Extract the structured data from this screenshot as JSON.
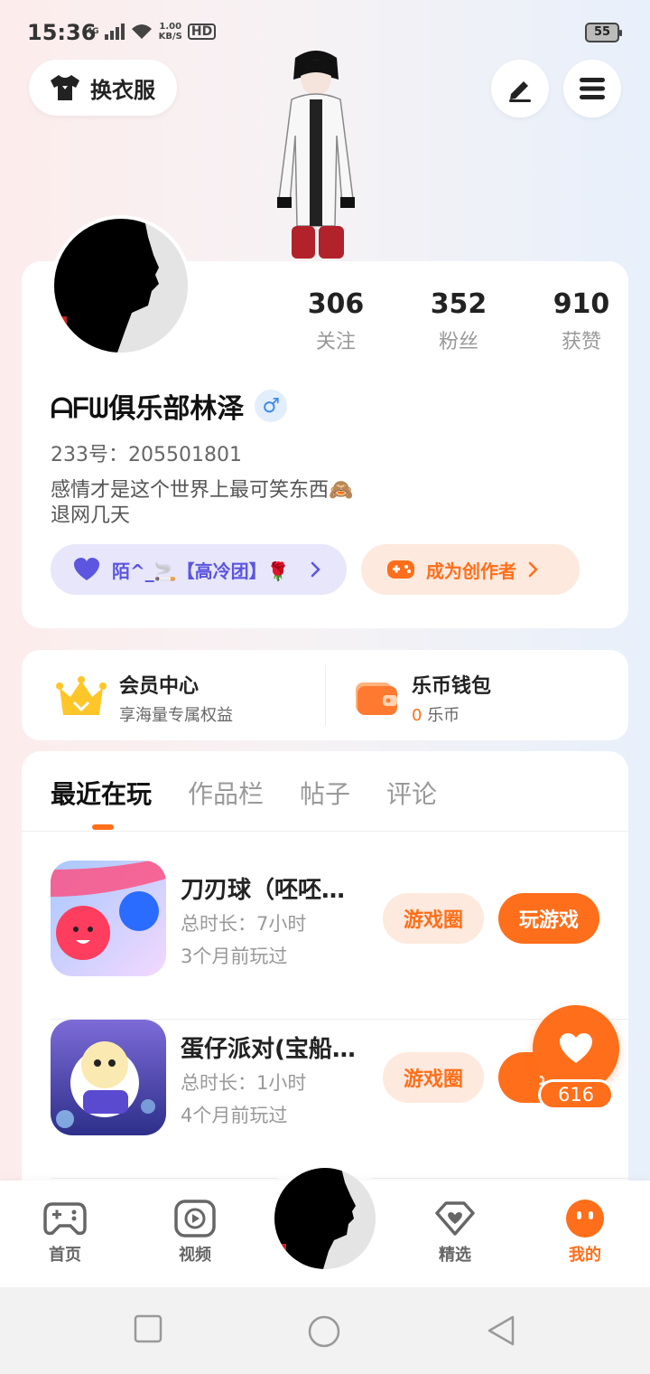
{
  "status_bar": {
    "time": "15:36",
    "network": "4G",
    "speed_value": "1.00",
    "speed_unit": "KB/S",
    "hd": "HD",
    "battery": "55"
  },
  "header": {
    "outfit_label": "换衣服",
    "edit_icon": "pen-icon",
    "menu_icon": "menu-icon"
  },
  "profile": {
    "stats": [
      {
        "value": "306",
        "label": "关注"
      },
      {
        "value": "352",
        "label": "粉丝"
      },
      {
        "value": "910",
        "label": "获赞"
      }
    ],
    "username": "ᗩᖴᗯ俱乐部林泽",
    "gender_symbol": "♂",
    "user_id": "233号：205501801",
    "bio_line1": "感情才是这个世界上最可笑东西🙈",
    "bio_line2": "退网几天",
    "group_pill": "陌^_🚬【高冷团】🌹",
    "creator_pill": "成为创作者",
    "accent_color": "#ff6e1a"
  },
  "member_wallet": {
    "member_title": "会员中心",
    "member_sub": "享海量专属权益",
    "wallet_title": "乐币钱包",
    "wallet_amount": "0",
    "wallet_unit": "乐币"
  },
  "tabs": [
    "最近在玩",
    "作品栏",
    "帖子",
    "评论"
  ],
  "games": [
    {
      "name": "刀刃球（呸呸…",
      "time": "总时长：7小时",
      "last": "3个月前玩过",
      "circle_label": "游戏圈",
      "play_label": "玩游戏"
    },
    {
      "name": "蛋仔派对(宝船…",
      "time": "总时长：1小时",
      "last": "4个月前玩过",
      "circle_label": "游戏圈",
      "play_label": "玩"
    }
  ],
  "like": {
    "count": "616"
  },
  "bottom_nav": [
    {
      "label": "首页",
      "icon": "gamepad-icon"
    },
    {
      "label": "视频",
      "icon": "video-icon"
    },
    {
      "label": "精选",
      "icon": "heart-diamond-icon"
    },
    {
      "label": "我的",
      "icon": "profile-face-icon"
    }
  ]
}
